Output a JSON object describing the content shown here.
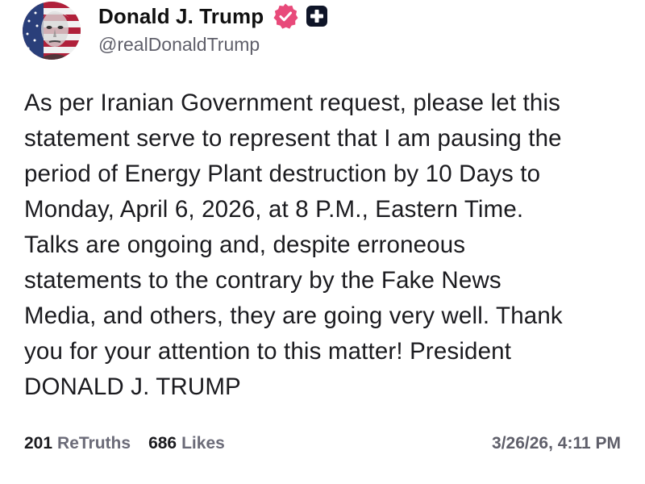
{
  "author": {
    "display_name": "Donald J. Trump",
    "handle": "@realDonaldTrump",
    "avatar_icon": "avatar-flag-portrait",
    "verified_icon": "verified-badge-icon",
    "verified_color": "#e84a7a",
    "plus_icon": "plus-badge-icon"
  },
  "post": {
    "body": "As per Iranian Government request, please let this\nstatement serve to represent that I am pausing the\nperiod of Energy Plant destruction by 10 Days to\nMonday, April 6, 2026, at 8 P.M., Eastern Time.\nTalks are ongoing and, despite erroneous\nstatements to the contrary by the Fake News\nMedia, and others, they are going very well. Thank\nyou for your attention to this matter! President\nDONALD J. TRUMP"
  },
  "stats": {
    "retruths_count": "201",
    "retruths_label": "ReTruths",
    "likes_count": "686",
    "likes_label": "Likes",
    "timestamp": "3/26/26, 4:11 PM"
  }
}
